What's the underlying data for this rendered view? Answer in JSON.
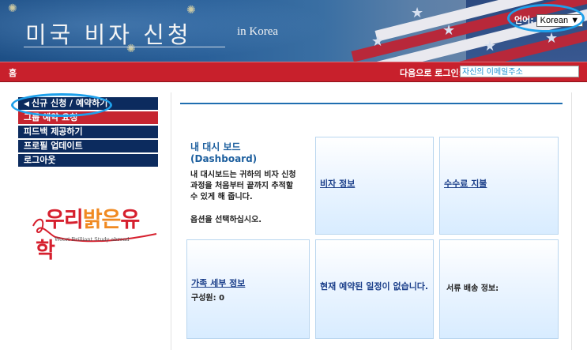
{
  "header": {
    "title_korean": "미국 비자 신청",
    "title_sub": "in Korea",
    "language_label": "언어:",
    "language_value": "Korean",
    "language_dropdown_arrow": "▼"
  },
  "navbar": {
    "home_label": "홈",
    "login_label": "다음으로 로그인:",
    "login_value": "자신의 이메일주소"
  },
  "sidebar": {
    "items": [
      {
        "label": "신규 신청 / 예약하기"
      },
      {
        "label": "그룹 예약 요청"
      },
      {
        "label": "피드백 제공하기"
      },
      {
        "label": "프로필 업데이트"
      },
      {
        "label": "로그아웃"
      }
    ]
  },
  "logo": {
    "text_part1": "우리",
    "text_part2": "밝은",
    "text_part3": "유학",
    "subtitle": "Woori Brilliant Study abroad"
  },
  "dashboard": {
    "title": "내 대시 보드(Dashboard)",
    "description": "내 대시보드는 귀하의 비자 신청 과정을 처음부터 끝까지 추적할 수 있게 해 줍니다.",
    "prompt": "옵션을 선택하십시오."
  },
  "tiles": {
    "visa_info": "비자 정보",
    "fee_payment": "수수료 지불",
    "family_info": "가족 세부 정보",
    "family_members": "구성원: 0",
    "no_appointment": "현재 예약된 일정이 없습니다.",
    "document_delivery": "서류 배송 정보:"
  },
  "colors": {
    "nav_red": "#c8202c",
    "sidebar_navy": "#0c2b5e",
    "accent_blue": "#1f6eb0",
    "highlight_ring": "#1ea0ea"
  }
}
